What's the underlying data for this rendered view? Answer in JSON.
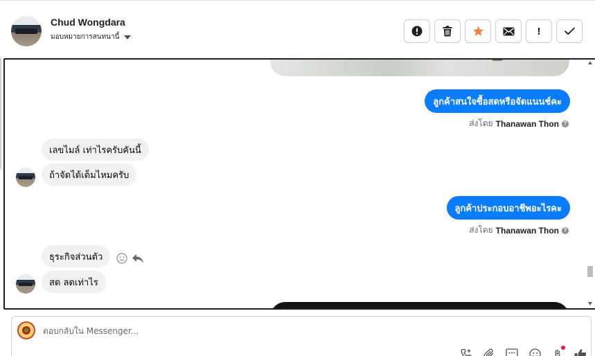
{
  "header": {
    "contact_name": "Chud Wongdara",
    "assign_label": "มอบหมายการสนทนานี้",
    "toolbar": [
      {
        "name": "mark-spam-button",
        "icon": "alert-circle-icon"
      },
      {
        "name": "delete-button",
        "icon": "trash-icon"
      },
      {
        "name": "star-button",
        "icon": "star-icon",
        "color": "#f5803e"
      },
      {
        "name": "mark-unread-button",
        "icon": "envelope-icon"
      },
      {
        "name": "follow-up-button",
        "icon": "exclamation-icon",
        "label": "!"
      },
      {
        "name": "mark-done-button",
        "icon": "check-icon"
      }
    ]
  },
  "messages": [
    {
      "side": "out",
      "text": "ลูกค้าสนใจซื้อสดหรือจัดแนนช์คะ",
      "sent_by_label": "ส่งโดย",
      "sender": "Thanawan Thon"
    },
    {
      "side": "in",
      "text": "เลขไมล์ เท่าไรครับคันนี้"
    },
    {
      "side": "in",
      "text": "ถ้าจัดได้เต็มไหมครับ"
    },
    {
      "side": "out",
      "text": "ลูกค้าประกอบอาชีพอะไรคะ",
      "sent_by_label": "ส่งโดย",
      "sender": "Thanawan Thon"
    },
    {
      "side": "in",
      "text": "ธุระกิจส่วนตัว"
    },
    {
      "side": "in",
      "text": "สด ลดเท่าไร"
    }
  ],
  "composer": {
    "placeholder": "ตอบกลับใน Messenger...",
    "tools": [
      "add-call-icon",
      "attachment-icon",
      "saved-reply-icon",
      "emoji-icon",
      "baht-icon",
      "like-icon"
    ]
  },
  "colors": {
    "outgoing_bubble": "#0a7cff",
    "incoming_bubble": "#f0f0f0",
    "star": "#f5803e"
  }
}
